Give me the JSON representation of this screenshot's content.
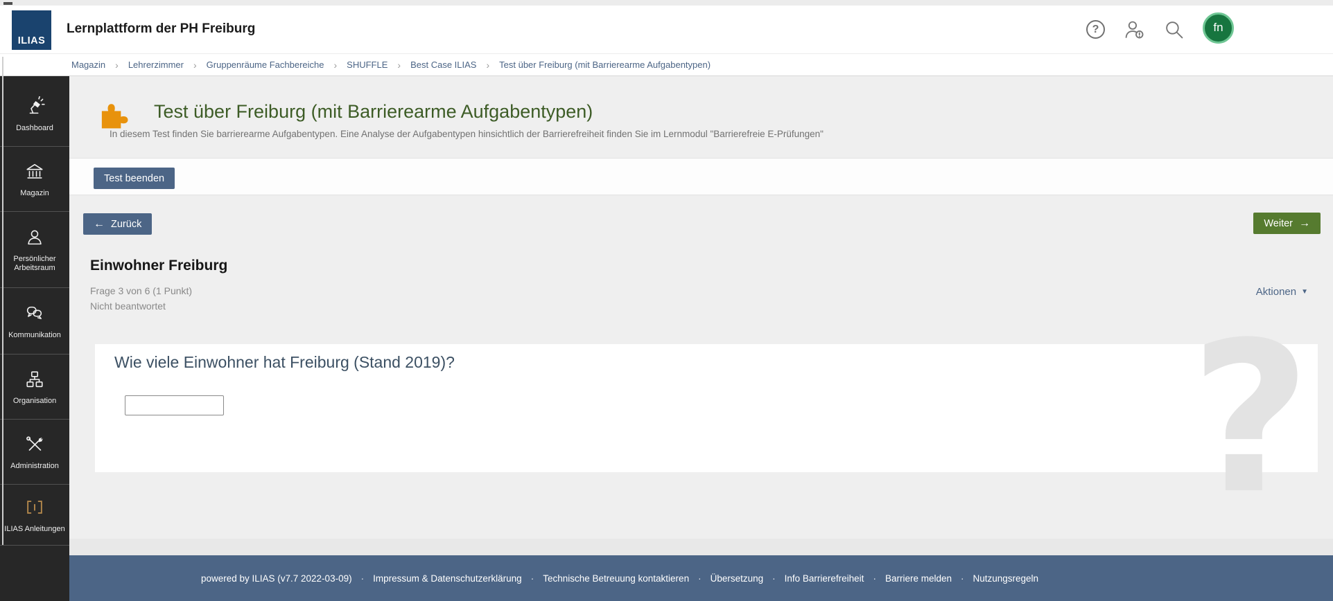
{
  "header": {
    "logo_text": "ILIAS",
    "title": "Lernplattform der PH Freiburg",
    "help_glyph": "?",
    "avatar_initials": "fn"
  },
  "breadcrumb": {
    "items": [
      "Magazin",
      "Lehrerzimmer",
      "Gruppenräume Fachbereiche",
      "SHUFFLE",
      "Best Case ILIAS",
      "Test über Freiburg (mit Barrierearme Aufgabentypen)"
    ]
  },
  "sidebar": {
    "items": [
      {
        "name": "dashboard",
        "label": "Dashboard",
        "icon": "dashboard-icon"
      },
      {
        "name": "magazin",
        "label": "Magazin",
        "icon": "repository-icon"
      },
      {
        "name": "arbeitsraum",
        "label": "Persönlicher Arbeitsraum",
        "icon": "user-icon"
      },
      {
        "name": "kommunikation",
        "label": "Kommunikation",
        "icon": "chat-icon"
      },
      {
        "name": "organisation",
        "label": "Organisation",
        "icon": "orgchart-icon"
      },
      {
        "name": "administration",
        "label": "Administration",
        "icon": "tools-icon"
      },
      {
        "name": "anleitungen",
        "label": "ILIAS Anleitungen",
        "icon": "manual-icon"
      }
    ]
  },
  "page": {
    "title": "Test über Freiburg (mit Barrierearme Aufgabentypen)",
    "subtitle": "In diesem Test finden Sie barrierearme Aufgabentypen. Eine Analyse der Aufgabentypen hinsichtlich der Barrierefreiheit finden Sie im Lernmodul \"Barrierefreie E-Prüfungen\"",
    "finish_button": "Test beenden",
    "back_button": "Zurück",
    "next_button": "Weiter"
  },
  "question": {
    "title": "Einwohner Freiburg",
    "meta_line1": "Frage 3 von 6 (1 Punkt)",
    "meta_line2": "Nicht beantwortet",
    "actions_label": "Aktionen",
    "prompt": "Wie viele Einwohner hat Freiburg (Stand 2019)?",
    "input_value": "",
    "watermark": "?"
  },
  "footer": {
    "powered": "powered by ILIAS (v7.7 2022-03-09)",
    "separator": "·",
    "links": [
      "Impressum & Datenschutzerklärung",
      "Technische Betreuung kontaktieren",
      "Übersetzung",
      "Info Barrierefreiheit",
      "Barriere melden",
      "Nutzungsregeln"
    ]
  },
  "colors": {
    "primary_slate": "#4c6586",
    "next_green": "#567b2f",
    "logo_navy": "#1a436e",
    "avatar_green": "#17753f",
    "avatar_ring": "#6fc694",
    "page_title_green": "#3d5c26",
    "test_icon_orange": "#e8920c",
    "sidebar_bg": "#272727",
    "footer_bg": "#4c6586",
    "watermark_gray": "#e3e3e3",
    "manual_icon_tan": "#b5894c"
  }
}
